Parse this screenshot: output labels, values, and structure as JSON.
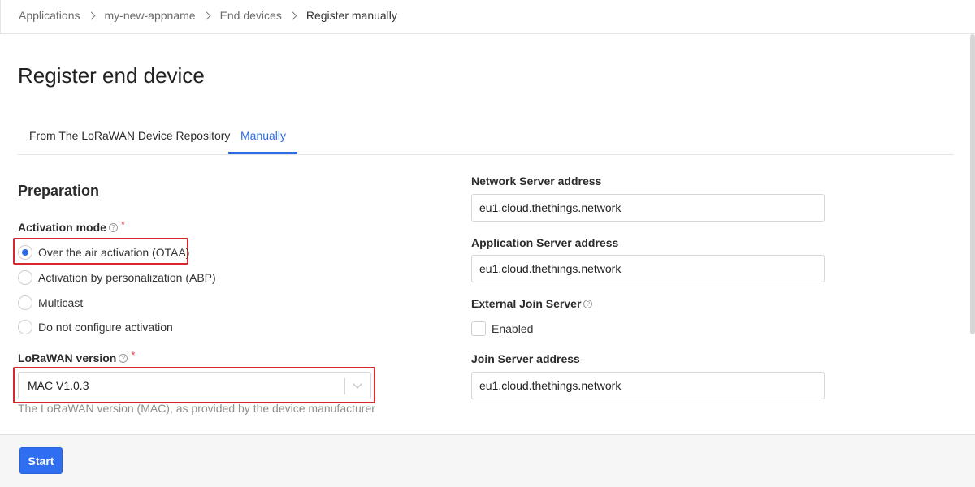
{
  "breadcrumb": {
    "items": [
      "Applications",
      "my-new-appname",
      "End devices",
      "Register manually"
    ]
  },
  "page": {
    "title": "Register end device"
  },
  "tabs": [
    {
      "label": "From The LoRaWAN Device Repository",
      "active": false
    },
    {
      "label": "Manually",
      "active": true
    }
  ],
  "preparation": {
    "title": "Preparation",
    "activation_mode": {
      "label": "Activation mode",
      "help_icon": "?",
      "required_mark": "*",
      "options": [
        {
          "label": "Over the air activation (OTAA)",
          "selected": true
        },
        {
          "label": "Activation by personalization (ABP)",
          "selected": false
        },
        {
          "label": "Multicast",
          "selected": false
        },
        {
          "label": "Do not configure activation",
          "selected": false
        }
      ]
    },
    "lorawan_version": {
      "label": "LoRaWAN version",
      "help_icon": "?",
      "required_mark": "*",
      "selected_value": "MAC V1.0.3",
      "hint": "The LoRaWAN version (MAC), as provided by the device manufacturer"
    }
  },
  "servers": {
    "network_server": {
      "label": "Network Server address",
      "value": "eu1.cloud.thethings.network"
    },
    "application_server": {
      "label": "Application Server address",
      "value": "eu1.cloud.thethings.network"
    },
    "external_join_server": {
      "label": "External Join Server",
      "help_icon": "?",
      "checkbox_label": "Enabled",
      "checked": false
    },
    "join_server": {
      "label": "Join Server address",
      "value": "eu1.cloud.thethings.network"
    }
  },
  "footer": {
    "start_label": "Start"
  },
  "colors": {
    "accent": "#2d6be3",
    "button": "#2f6ef0",
    "highlight_border": "#d9272e",
    "required": "#e0404a"
  }
}
